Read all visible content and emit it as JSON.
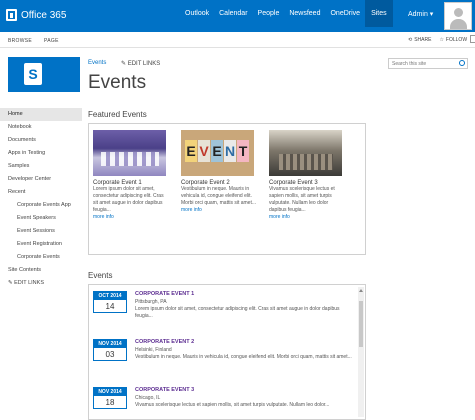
{
  "suite": {
    "brand": "Office 365",
    "nav": [
      "Outlook",
      "Calendar",
      "People",
      "Newsfeed",
      "OneDrive",
      "Sites"
    ],
    "active": "Sites",
    "admin": "Admin"
  },
  "ribbon": {
    "tabs": [
      "BROWSE",
      "PAGE"
    ],
    "share": "SHARE",
    "follow": "FOLLOW"
  },
  "header": {
    "breadcrumb": "Events",
    "edit_links": "EDIT LINKS",
    "title": "Events",
    "search_placeholder": "Search this site"
  },
  "leftnav": {
    "items": [
      {
        "label": "Home",
        "selected": true,
        "sub": false
      },
      {
        "label": "Notebook",
        "sub": false
      },
      {
        "label": "Documents",
        "sub": false
      },
      {
        "label": "Apps in Testing",
        "sub": false
      },
      {
        "label": "Samples",
        "sub": false
      },
      {
        "label": "Developer Center",
        "sub": false
      },
      {
        "label": "Recent",
        "sub": false
      },
      {
        "label": "Corporate Events App",
        "sub": true
      },
      {
        "label": "Event Speakers",
        "sub": true
      },
      {
        "label": "Event Sessions",
        "sub": true
      },
      {
        "label": "Event Registration",
        "sub": true
      },
      {
        "label": "Corporate Events",
        "sub": true
      },
      {
        "label": "Site Contents",
        "sub": false
      }
    ],
    "edit_links": "EDIT LINKS"
  },
  "featured": {
    "title": "Featured Events",
    "cards": [
      {
        "title": "Corporate Event 1",
        "desc": "Lorem ipsum dolor sit amet, consectetur adipiscing elit. Cras sit amet augue in dolor dapibus feugia...",
        "more": "more info"
      },
      {
        "title": "Corporate Event 2",
        "desc": "Vestibulum in neque. Mauris in vehicula id, congue eleifend elit. Morbi orci quam, mattis sit amet...",
        "more": "more info"
      },
      {
        "title": "Corporate Event 3",
        "desc": "Vivamus scelerisque lectus et sapien mollis, sit amet turpis vulputate. Nullam leo dolor dapibus feugia...",
        "more": "more info"
      }
    ],
    "card2_letters": [
      "E",
      "V",
      "E",
      "N",
      "T"
    ]
  },
  "events": {
    "title": "Events",
    "items": [
      {
        "month": "OCT 2014",
        "day": "14",
        "title": "CORPORATE EVENT 1",
        "location": "Pittsburgh, PA",
        "desc": "Lorem ipsum dolor sit amet, consectetur adipiscing elit. Cras sit amet augue in dolor dapibus feugia..."
      },
      {
        "month": "NOV 2014",
        "day": "03",
        "title": "CORPORATE EVENT 2",
        "location": "Helsinki, Finland",
        "desc": "Vestibulum in neque. Mauris in vehicula id, congue eleifend elit. Morbi orci quam, mattis sit amet..."
      },
      {
        "month": "NOV 2014",
        "day": "18",
        "title": "CORPORATE EVENT 3",
        "location": "Chicago, IL",
        "desc": "Vivamus scelerisque lectus et sapien mollis, sit amet turpis vulputate. Nullam leo dolor..."
      }
    ]
  },
  "colors": {
    "suite": "#0072c6",
    "accent": "#0072c6",
    "event_title": "#5c2d91"
  }
}
